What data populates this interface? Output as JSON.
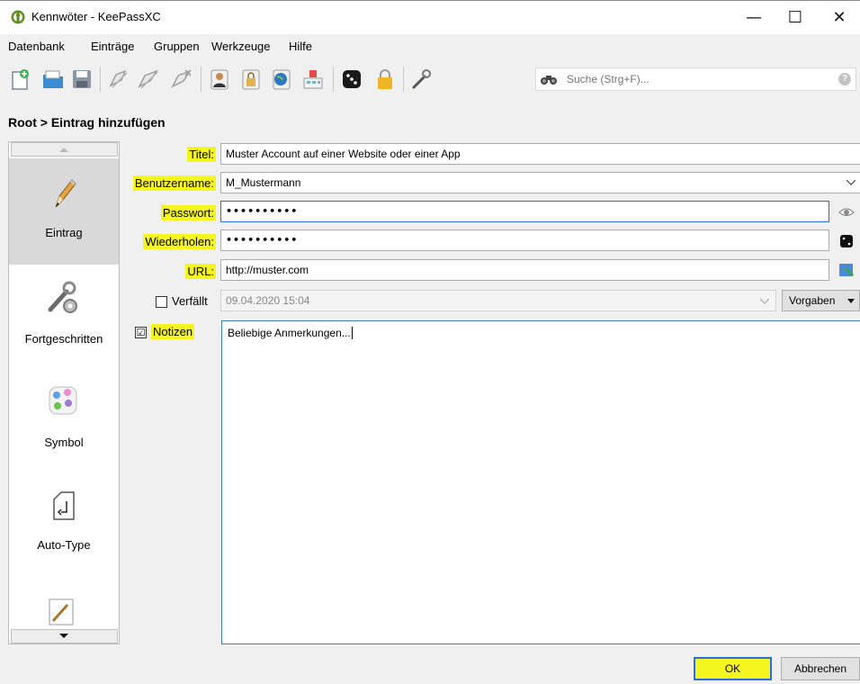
{
  "window": {
    "title": "Kennwöter - KeePassXC",
    "minimize": "—",
    "maximize": "☐",
    "close": "✕"
  },
  "menu": [
    "Datenbank",
    "Einträge",
    "Gruppen",
    "Werkzeuge",
    "Hilfe"
  ],
  "toolbar": {
    "icons": [
      "new-database-icon",
      "open-database-icon",
      "save-database-icon",
      "add-entry-icon",
      "edit-entry-icon",
      "delete-entry-icon",
      "copy-username-icon",
      "copy-password-icon",
      "copy-url-icon",
      "auto-type-icon",
      "password-generator-icon",
      "lock-database-icon",
      "settings-icon"
    ],
    "search_placeholder": "Suche (Strg+F)...",
    "search_help": "?"
  },
  "page_title": "Root > Eintrag hinzufügen",
  "categories": [
    {
      "label": "Eintrag",
      "icon": "pencil-icon",
      "active": true
    },
    {
      "label": "Fortgeschritten",
      "icon": "wrench-gear-icon",
      "active": false
    },
    {
      "label": "Symbol",
      "icon": "palette-icon",
      "active": false
    },
    {
      "label": "Auto-Type",
      "icon": "return-key-icon",
      "active": false
    }
  ],
  "form": {
    "title_label": "Titel:",
    "title_value": "Muster Account auf einer Website oder einer App",
    "username_label": "Benutzername:",
    "username_value": "M_Mustermann",
    "password_label": "Passwort:",
    "password_value": "••••••••••",
    "repeat_label": "Wiederholen:",
    "repeat_value": "••••••••••",
    "url_label": "URL:",
    "url_value": "http://muster.com",
    "expires_label": "Verfällt",
    "expires_value": "09.04.2020 15:04",
    "presets_label": "Vorgaben",
    "notes_label": "Notizen",
    "notes_value": "Beliebige Anmerkungen...",
    "notes_checked": "☑"
  },
  "buttons": {
    "ok": "OK",
    "cancel": "Abbrechen"
  },
  "colors": {
    "highlight": "#f5f51f",
    "focus": "#2a6fd6",
    "active_category": "#d9d9d9"
  }
}
